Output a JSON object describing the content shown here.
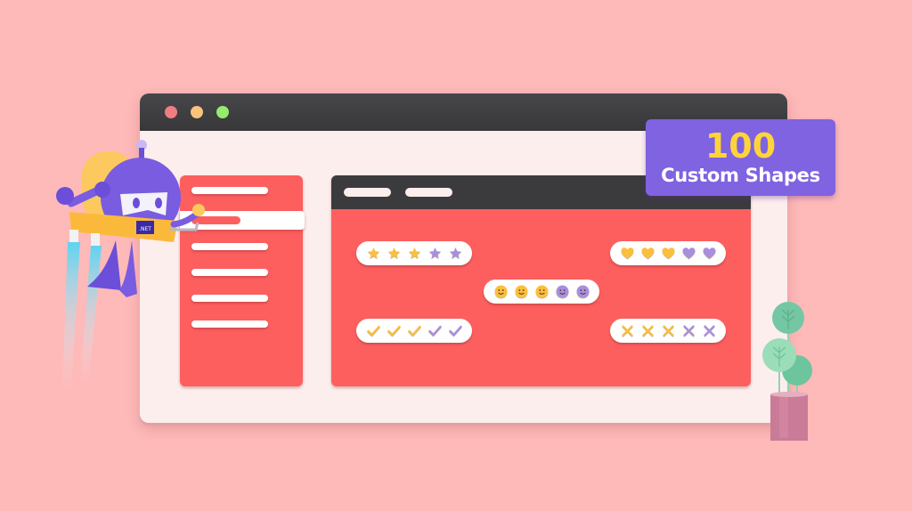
{
  "badge": {
    "number": "100",
    "label": "Custom Shapes"
  },
  "colors": {
    "background": "#feb9b9",
    "window_body": "#fdeeee",
    "titlebar": "#3b3b3d",
    "panel_red": "#fd5f5f",
    "badge_purple": "#7f63e0",
    "badge_number": "#ffd43b",
    "filled_shape": "#fcbf3b",
    "empty_shape": "#a98ede"
  },
  "window": {
    "traffic_lights": [
      "close",
      "minimize",
      "maximize"
    ]
  },
  "sidebar": {
    "item_count": 6,
    "selected_index": 1
  },
  "main": {
    "tab_count": 2
  },
  "ratings": [
    {
      "shape": "star",
      "value": 3,
      "max": 5
    },
    {
      "shape": "heart",
      "value": 3,
      "max": 5
    },
    {
      "shape": "smiley",
      "value": 3,
      "max": 5
    },
    {
      "shape": "check",
      "value": 3,
      "max": 5
    },
    {
      "shape": "cross",
      "value": 3,
      "max": 5
    }
  ],
  "mascot": {
    "label": ".NET"
  }
}
